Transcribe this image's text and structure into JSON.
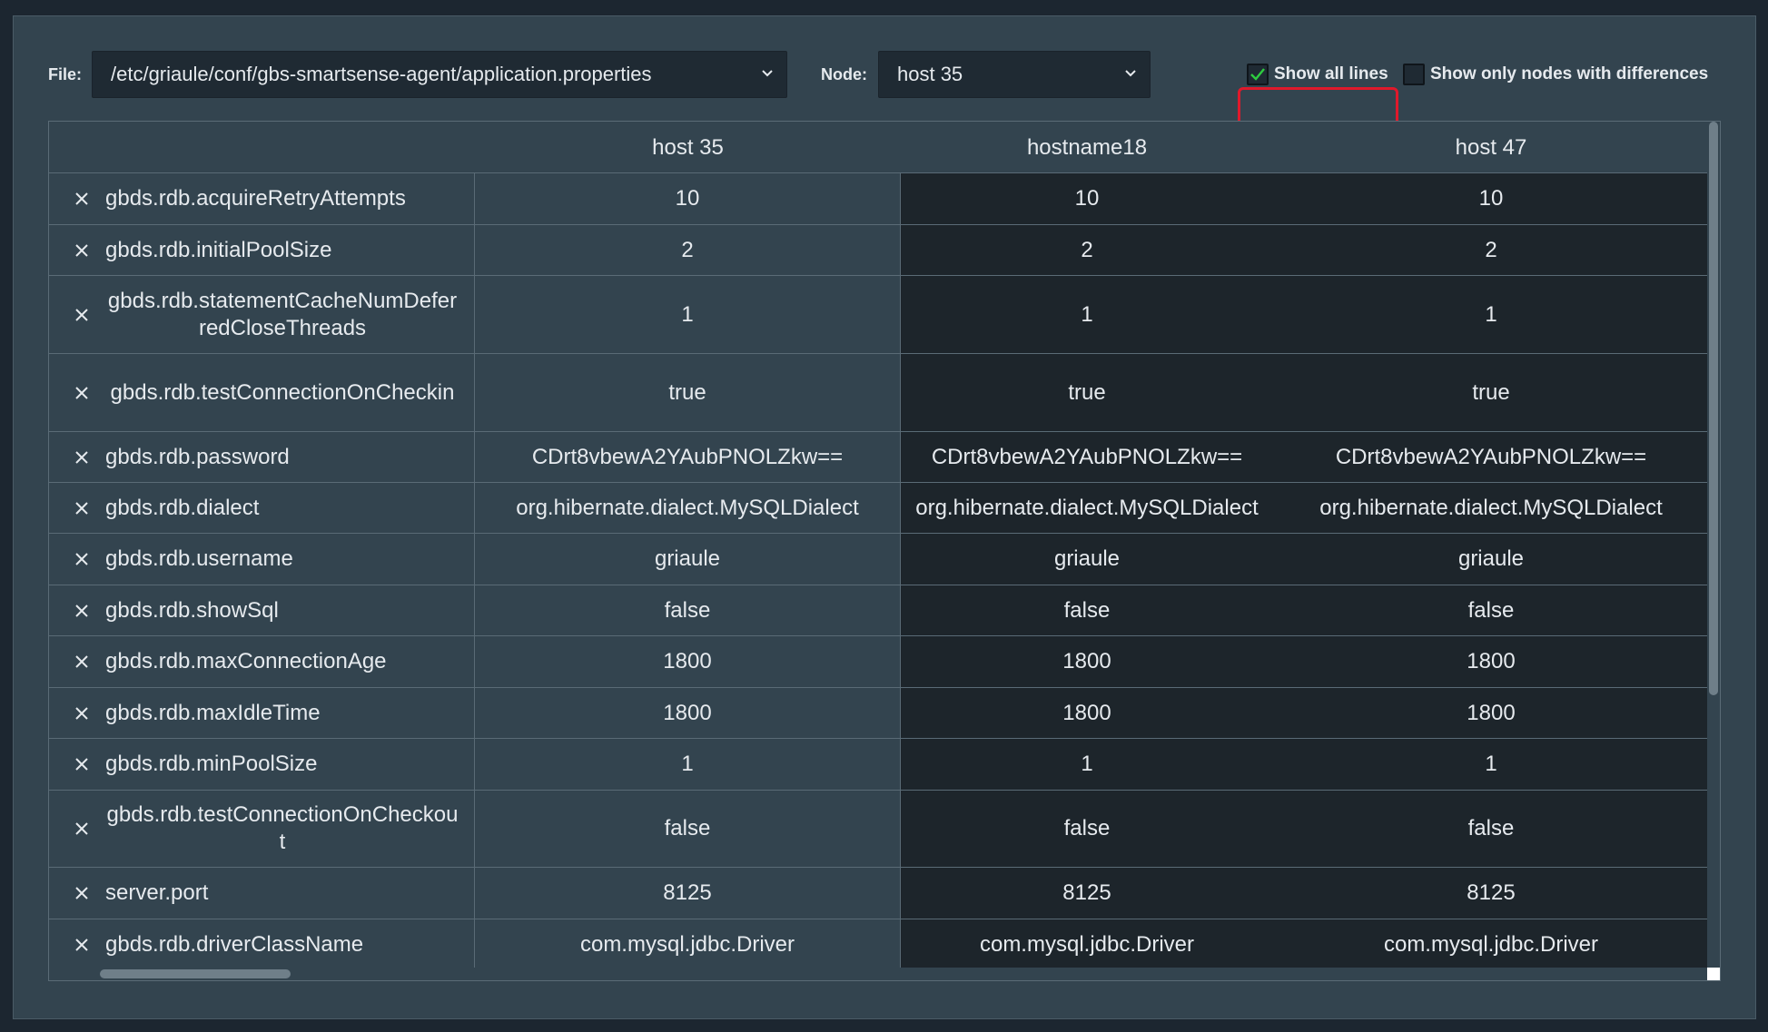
{
  "toolbar": {
    "file_label": "File:",
    "file_value": "/etc/griaule/conf/gbs-smartsense-agent/application.properties",
    "node_label": "Node:",
    "node_value": "host 35",
    "show_all_lines": {
      "label": "Show all lines",
      "checked": true
    },
    "show_only_diff": {
      "label": "Show only nodes with differences",
      "checked": false
    }
  },
  "table": {
    "columns": [
      "",
      "host 35",
      "hostname18",
      "host 47"
    ],
    "rows": [
      {
        "key": "gbds.rdb.acquireRetryAttempts",
        "values": [
          "10",
          "10",
          "10"
        ]
      },
      {
        "key": "gbds.rdb.initialPoolSize",
        "values": [
          "2",
          "2",
          "2"
        ]
      },
      {
        "key": "gbds.rdb.statementCacheNumDeferredCloseThreads",
        "values": [
          "1",
          "1",
          "1"
        ]
      },
      {
        "key": "gbds.rdb.testConnectionOnCheckin",
        "values": [
          "true",
          "true",
          "true"
        ]
      },
      {
        "key": "gbds.rdb.password",
        "values": [
          "CDrt8vbewA2YAubPNOLZkw==",
          "CDrt8vbewA2YAubPNOLZkw==",
          "CDrt8vbewA2YAubPNOLZkw=="
        ]
      },
      {
        "key": "gbds.rdb.dialect",
        "values": [
          "org.hibernate.dialect.MySQLDialect",
          "org.hibernate.dialect.MySQLDialect",
          "org.hibernate.dialect.MySQLDialect"
        ]
      },
      {
        "key": "gbds.rdb.username",
        "values": [
          "griaule",
          "griaule",
          "griaule"
        ]
      },
      {
        "key": "gbds.rdb.showSql",
        "values": [
          "false",
          "false",
          "false"
        ]
      },
      {
        "key": "gbds.rdb.maxConnectionAge",
        "values": [
          "1800",
          "1800",
          "1800"
        ]
      },
      {
        "key": "gbds.rdb.maxIdleTime",
        "values": [
          "1800",
          "1800",
          "1800"
        ]
      },
      {
        "key": "gbds.rdb.minPoolSize",
        "values": [
          "1",
          "1",
          "1"
        ]
      },
      {
        "key": "gbds.rdb.testConnectionOnCheckout",
        "values": [
          "false",
          "false",
          "false"
        ]
      },
      {
        "key": "server.port",
        "values": [
          "8125",
          "8125",
          "8125"
        ]
      },
      {
        "key": "gbds.rdb.driverClassName",
        "values": [
          "com.mysql.jdbc.Driver",
          "com.mysql.jdbc.Driver",
          "com.mysql.jdbc.Driver"
        ]
      }
    ]
  },
  "colors": {
    "background": "#1c2630",
    "panel": "#33444f",
    "dark_cell": "#1d252b",
    "highlight": "#e0192b",
    "check": "#2ecc40"
  }
}
